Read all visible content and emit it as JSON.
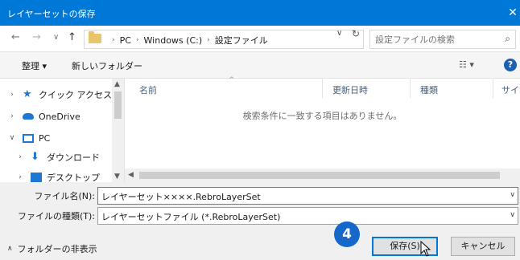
{
  "window": {
    "title": "レイヤーセットの保存",
    "close_glyph": "✕"
  },
  "nav": {
    "back": "←",
    "forward": "→",
    "recent": "∨",
    "up": "↑"
  },
  "address": {
    "breadcrumbs": [
      "PC",
      "Windows (C:)",
      "設定ファイル"
    ],
    "dropdown": "∨",
    "refresh": "↻"
  },
  "search": {
    "placeholder": "設定ファイルの検索",
    "icon": "⌕"
  },
  "toolbar": {
    "organize": "整理 ▾",
    "new_folder": "新しいフォルダー",
    "view": "☷ ▾",
    "help": "?"
  },
  "sidebar": {
    "items": [
      {
        "label": "クイック アクセス",
        "icon": "star-icon",
        "chevron": "›"
      },
      {
        "label": "OneDrive",
        "icon": "cloud-icon",
        "chevron": "›"
      },
      {
        "label": "PC",
        "icon": "computer-icon",
        "chevron": "∨"
      },
      {
        "label": "ダウンロード",
        "icon": "download-icon",
        "chevron": "›"
      },
      {
        "label": "デスクトップ",
        "icon": "desktop-icon",
        "chevron": "›"
      }
    ]
  },
  "file_list": {
    "columns": [
      "名前",
      "更新日時",
      "種類",
      "サイ"
    ],
    "empty_message": "検索条件に一致する項目はありません。"
  },
  "form": {
    "filename_label": "ファイル名(N):",
    "filename_value": "レイヤーセット××××.RebroLayerSet",
    "filetype_label": "ファイルの種類(T):",
    "filetype_value": "レイヤーセットファイル (*.RebroLayerSet)"
  },
  "footer": {
    "hide_folders": "フォルダーの非表示",
    "step_badge": "4",
    "save": "保存(S)",
    "cancel": "キャンセル"
  },
  "colors": {
    "accent": "#0078d7",
    "badge": "#1568c9"
  }
}
